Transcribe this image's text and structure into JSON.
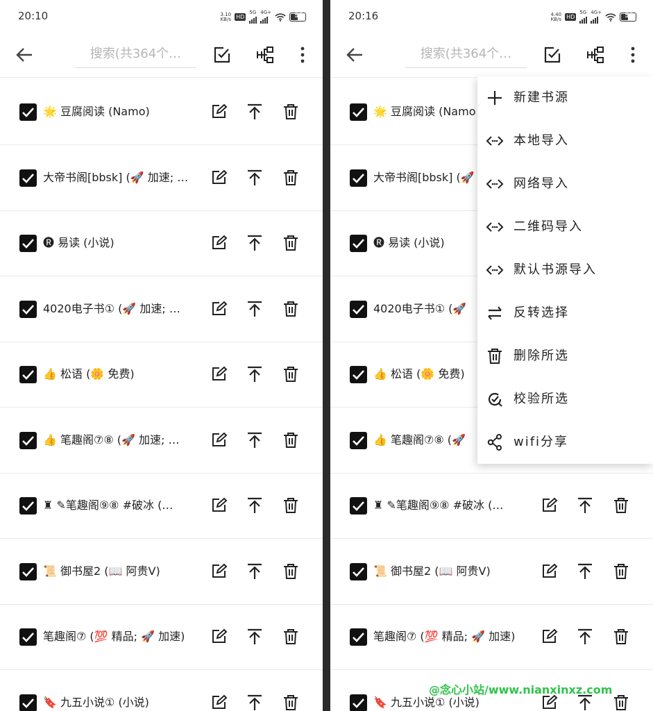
{
  "screens": [
    {
      "time": "20:10",
      "speed_value": "3.10",
      "speed_unit": "KB/s",
      "network": "5G",
      "lte": "4G+",
      "battery": "55"
    },
    {
      "time": "20:16",
      "speed_value": "4.40",
      "speed_unit": "KB/s",
      "network": "5G",
      "lte": "4G+",
      "battery": "52"
    }
  ],
  "status_badge": "HD",
  "search": {
    "placeholder": "搜索(共364个…"
  },
  "toolbar_icons": [
    "back-arrow-icon",
    "select-edit-icon",
    "group-icon",
    "more-vert-icon"
  ],
  "row_icons": [
    "edit-icon",
    "top-arrow-icon",
    "delete-icon"
  ],
  "rows": [
    {
      "left": "🌟 豆腐阅读 (Namo)",
      "right": "🌟 豆腐阅读 (Namo"
    },
    {
      "left": "大帝书阁[bbsk] (🚀 加速; …",
      "right": "大帝书阁[bbsk] (🚀"
    },
    {
      "left": "🅡 易读 (小说)",
      "right": "🅡 易读 (小说)"
    },
    {
      "left": "4020电子书① (🚀 加速; …",
      "right": "4020电子书① (🚀"
    },
    {
      "left": "👍 松语 (🌼 免费)",
      "right": "👍 松语 (🌼 免费)"
    },
    {
      "left": "👍 笔趣阁⑦⑧ (🚀 加速; …",
      "right": "👍 笔趣阁⑦⑧ (🚀"
    },
    {
      "left": "♜ ✎笔趣阁⑨⑧ #破冰 (…",
      "right": "♜ ✎笔趣阁⑨⑧ #破冰 (…"
    },
    {
      "left": "📜 御书屋2 (📖 阿贵V)",
      "right": "📜 御书屋2 (📖 阿贵V)"
    },
    {
      "left": "笔趣阁⑦ (💯 精品; 🚀 加速)",
      "right": "笔趣阁⑦ (💯 精品; 🚀 加速)"
    },
    {
      "left": "🔖 九五小说① (小说)",
      "right": "🔖 九五小说① (小说)"
    }
  ],
  "menu": [
    {
      "label": "新建书源",
      "icon": "plus-icon"
    },
    {
      "label": "本地导入",
      "icon": "code-import-icon"
    },
    {
      "label": "网络导入",
      "icon": "code-import-icon"
    },
    {
      "label": "二维码导入",
      "icon": "code-import-icon"
    },
    {
      "label": "默认书源导入",
      "icon": "code-import-icon"
    },
    {
      "label": "反转选择",
      "icon": "swap-icon"
    },
    {
      "label": "删除所选",
      "icon": "trash-icon"
    },
    {
      "label": "校验所选",
      "icon": "check-search-icon"
    },
    {
      "label": "wifi分享",
      "icon": "share-icon"
    }
  ],
  "watermark": "@念心小站/www.nianxinxz.com"
}
